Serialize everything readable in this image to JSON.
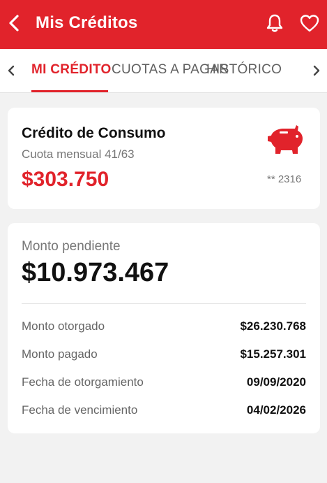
{
  "header": {
    "title": "Mis Créditos",
    "back_icon": "chevron-left-icon",
    "notifications_icon": "bell-icon",
    "favorites_icon": "heart-icon",
    "brand_color": "#e1232b"
  },
  "tabs": {
    "items": [
      {
        "label": "MI CRÉDITO",
        "active": true
      },
      {
        "label": "CUOTAS A PAGAR",
        "active": false
      },
      {
        "label": "HISTÓRICO",
        "active": false
      }
    ]
  },
  "credit": {
    "title": "Crédito de Consumo",
    "installment": "Cuota mensual 41/63",
    "amount": "$303.750",
    "account": "** 2316",
    "icon": "piggy-bank-icon"
  },
  "summary": {
    "pending_label": "Monto pendiente",
    "pending_amount": "$10.973.467",
    "rows": [
      {
        "label": "Monto otorgado",
        "value": "$26.230.768"
      },
      {
        "label": "Monto pagado",
        "value": "$15.257.301"
      },
      {
        "label": "Fecha de otorgamiento",
        "value": "09/09/2020"
      },
      {
        "label": "Fecha de vencimiento",
        "value": "04/02/2026"
      }
    ]
  }
}
